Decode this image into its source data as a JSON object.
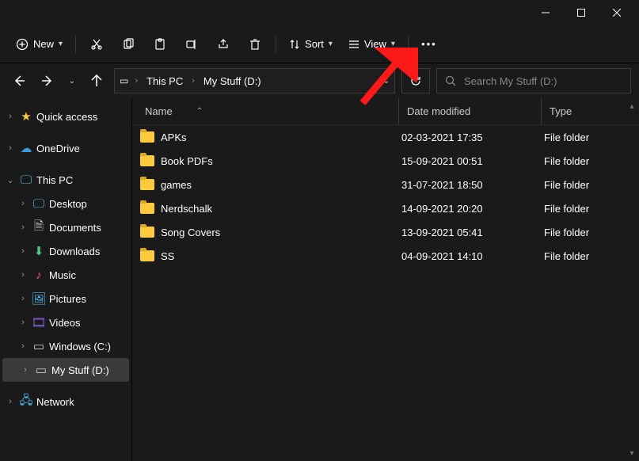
{
  "window_controls": {
    "min": "minimize",
    "max": "maximize",
    "close": "close"
  },
  "toolbar": {
    "new": "New",
    "sort": "Sort",
    "view": "View"
  },
  "breadcrumb": {
    "root": "This PC",
    "current": "My Stuff (D:)"
  },
  "search": {
    "placeholder": "Search My Stuff (D:)"
  },
  "columns": {
    "name": "Name",
    "date": "Date modified",
    "type": "Type"
  },
  "sidebar": {
    "quick_access": "Quick access",
    "onedrive": "OneDrive",
    "this_pc": "This PC",
    "desktop": "Desktop",
    "documents": "Documents",
    "downloads": "Downloads",
    "music": "Music",
    "pictures": "Pictures",
    "videos": "Videos",
    "windows_c": "Windows (C:)",
    "my_stuff_d": "My Stuff (D:)",
    "network": "Network"
  },
  "items": [
    {
      "name": "APKs",
      "date": "02-03-2021 17:35",
      "type": "File folder"
    },
    {
      "name": "Book PDFs",
      "date": "15-09-2021 00:51",
      "type": "File folder"
    },
    {
      "name": "games",
      "date": "31-07-2021 18:50",
      "type": "File folder"
    },
    {
      "name": "Nerdschalk",
      "date": "14-09-2021 20:20",
      "type": "File folder"
    },
    {
      "name": "Song Covers",
      "date": "13-09-2021 05:41",
      "type": "File folder"
    },
    {
      "name": "SS",
      "date": "04-09-2021 14:10",
      "type": "File folder"
    }
  ]
}
